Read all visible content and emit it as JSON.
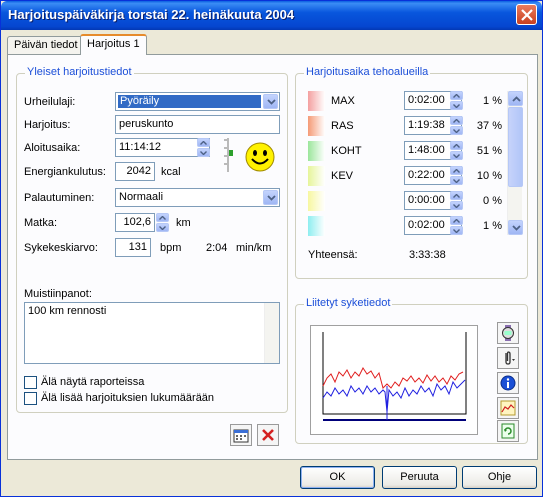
{
  "window": {
    "title": "Harjoituspäiväkirja torstai 22. heinäkuuta 2004"
  },
  "tabs": [
    {
      "label": "Päivän tiedot"
    },
    {
      "label": "Harjoitus 1"
    }
  ],
  "general": {
    "title": "Yleiset harjoitustiedot",
    "sport": {
      "label": "Urheilulaji:",
      "value": "Pyöräily"
    },
    "exercise": {
      "label": "Harjoitus:",
      "value": "peruskunto"
    },
    "start_time": {
      "label": "Aloitusaika:",
      "value": "11:14:12"
    },
    "energy": {
      "label": "Energiankulutus:",
      "value": "2042",
      "unit": "kcal"
    },
    "recovery": {
      "label": "Palautuminen:",
      "value": "Normaali"
    },
    "distance": {
      "label": "Matka:",
      "value": "102,6",
      "unit": "km"
    },
    "hr_avg": {
      "label": "Sykekeskiarvo:",
      "value": "131",
      "unit": "bpm",
      "pace": "2:04",
      "pace_unit": "min/km"
    }
  },
  "notes": {
    "label": "Muistiinpanot:",
    "text": "100 km rennosti"
  },
  "checkboxes": [
    {
      "label": "Älä näytä raporteissa",
      "checked": false
    },
    {
      "label": "Älä lisää harjoituksien lukumäärään",
      "checked": false
    }
  ],
  "zones": {
    "title": "Harjoitusaika tehoalueilla",
    "rows": [
      {
        "name": "MAX",
        "time": "0:02:00",
        "percent": "1 %",
        "color": "#f4a0a0"
      },
      {
        "name": "RAS",
        "time": "1:19:38",
        "percent": "37 %",
        "color": "#f59a76"
      },
      {
        "name": "KOHT",
        "time": "1:48:00",
        "percent": "51 %",
        "color": "#9be69b"
      },
      {
        "name": "KEV",
        "time": "0:22:00",
        "percent": "10 %",
        "color": "#e6f59a"
      },
      {
        "name": "",
        "time": "0:00:00",
        "percent": "0 %",
        "color": "#f7f7a0"
      },
      {
        "name": "",
        "time": "0:02:00",
        "percent": "1 %",
        "color": "#8eeef0"
      }
    ],
    "total_label": "Yhteensä:",
    "total_value": "3:33:38"
  },
  "hr_data": {
    "title": "Liitetyt syketiedot"
  },
  "buttons": {
    "ok": "OK",
    "cancel": "Peruuta",
    "help": "Ohje"
  },
  "icons": {
    "title_close": "close-icon",
    "smiley": "smiley-icon",
    "slider": "intensity-slider-icon",
    "calendar": "calendar-icon",
    "delete": "delete-x-icon",
    "watch": "watch-icon",
    "attach": "paperclip-icon",
    "info": "info-icon",
    "graph": "graph-icon",
    "refresh": "refresh-icon"
  }
}
